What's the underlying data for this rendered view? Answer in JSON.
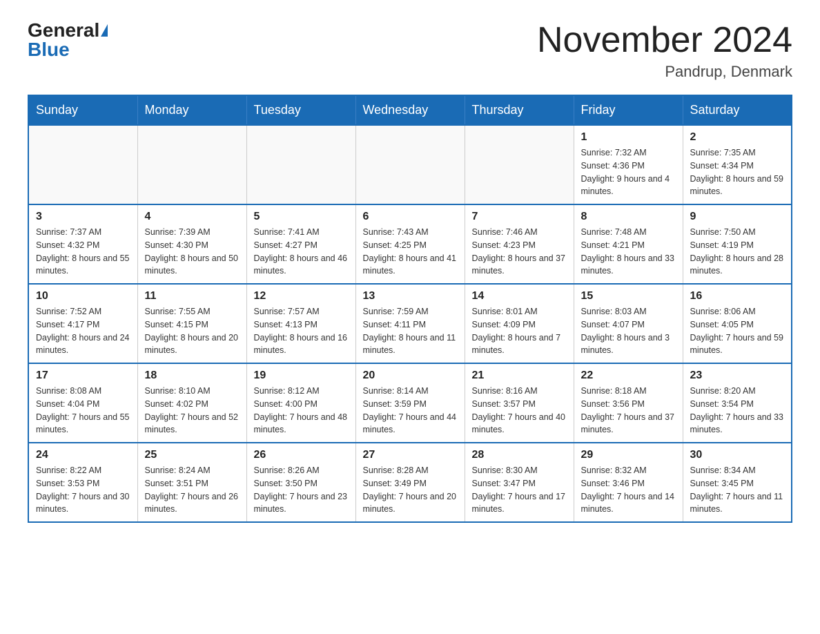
{
  "header": {
    "logo_general": "General",
    "logo_blue": "Blue",
    "month_title": "November 2024",
    "location": "Pandrup, Denmark"
  },
  "calendar": {
    "days_of_week": [
      "Sunday",
      "Monday",
      "Tuesday",
      "Wednesday",
      "Thursday",
      "Friday",
      "Saturday"
    ],
    "weeks": [
      {
        "days": [
          {
            "number": "",
            "info": ""
          },
          {
            "number": "",
            "info": ""
          },
          {
            "number": "",
            "info": ""
          },
          {
            "number": "",
            "info": ""
          },
          {
            "number": "",
            "info": ""
          },
          {
            "number": "1",
            "info": "Sunrise: 7:32 AM\nSunset: 4:36 PM\nDaylight: 9 hours\nand 4 minutes."
          },
          {
            "number": "2",
            "info": "Sunrise: 7:35 AM\nSunset: 4:34 PM\nDaylight: 8 hours\nand 59 minutes."
          }
        ]
      },
      {
        "days": [
          {
            "number": "3",
            "info": "Sunrise: 7:37 AM\nSunset: 4:32 PM\nDaylight: 8 hours\nand 55 minutes."
          },
          {
            "number": "4",
            "info": "Sunrise: 7:39 AM\nSunset: 4:30 PM\nDaylight: 8 hours\nand 50 minutes."
          },
          {
            "number": "5",
            "info": "Sunrise: 7:41 AM\nSunset: 4:27 PM\nDaylight: 8 hours\nand 46 minutes."
          },
          {
            "number": "6",
            "info": "Sunrise: 7:43 AM\nSunset: 4:25 PM\nDaylight: 8 hours\nand 41 minutes."
          },
          {
            "number": "7",
            "info": "Sunrise: 7:46 AM\nSunset: 4:23 PM\nDaylight: 8 hours\nand 37 minutes."
          },
          {
            "number": "8",
            "info": "Sunrise: 7:48 AM\nSunset: 4:21 PM\nDaylight: 8 hours\nand 33 minutes."
          },
          {
            "number": "9",
            "info": "Sunrise: 7:50 AM\nSunset: 4:19 PM\nDaylight: 8 hours\nand 28 minutes."
          }
        ]
      },
      {
        "days": [
          {
            "number": "10",
            "info": "Sunrise: 7:52 AM\nSunset: 4:17 PM\nDaylight: 8 hours\nand 24 minutes."
          },
          {
            "number": "11",
            "info": "Sunrise: 7:55 AM\nSunset: 4:15 PM\nDaylight: 8 hours\nand 20 minutes."
          },
          {
            "number": "12",
            "info": "Sunrise: 7:57 AM\nSunset: 4:13 PM\nDaylight: 8 hours\nand 16 minutes."
          },
          {
            "number": "13",
            "info": "Sunrise: 7:59 AM\nSunset: 4:11 PM\nDaylight: 8 hours\nand 11 minutes."
          },
          {
            "number": "14",
            "info": "Sunrise: 8:01 AM\nSunset: 4:09 PM\nDaylight: 8 hours\nand 7 minutes."
          },
          {
            "number": "15",
            "info": "Sunrise: 8:03 AM\nSunset: 4:07 PM\nDaylight: 8 hours\nand 3 minutes."
          },
          {
            "number": "16",
            "info": "Sunrise: 8:06 AM\nSunset: 4:05 PM\nDaylight: 7 hours\nand 59 minutes."
          }
        ]
      },
      {
        "days": [
          {
            "number": "17",
            "info": "Sunrise: 8:08 AM\nSunset: 4:04 PM\nDaylight: 7 hours\nand 55 minutes."
          },
          {
            "number": "18",
            "info": "Sunrise: 8:10 AM\nSunset: 4:02 PM\nDaylight: 7 hours\nand 52 minutes."
          },
          {
            "number": "19",
            "info": "Sunrise: 8:12 AM\nSunset: 4:00 PM\nDaylight: 7 hours\nand 48 minutes."
          },
          {
            "number": "20",
            "info": "Sunrise: 8:14 AM\nSunset: 3:59 PM\nDaylight: 7 hours\nand 44 minutes."
          },
          {
            "number": "21",
            "info": "Sunrise: 8:16 AM\nSunset: 3:57 PM\nDaylight: 7 hours\nand 40 minutes."
          },
          {
            "number": "22",
            "info": "Sunrise: 8:18 AM\nSunset: 3:56 PM\nDaylight: 7 hours\nand 37 minutes."
          },
          {
            "number": "23",
            "info": "Sunrise: 8:20 AM\nSunset: 3:54 PM\nDaylight: 7 hours\nand 33 minutes."
          }
        ]
      },
      {
        "days": [
          {
            "number": "24",
            "info": "Sunrise: 8:22 AM\nSunset: 3:53 PM\nDaylight: 7 hours\nand 30 minutes."
          },
          {
            "number": "25",
            "info": "Sunrise: 8:24 AM\nSunset: 3:51 PM\nDaylight: 7 hours\nand 26 minutes."
          },
          {
            "number": "26",
            "info": "Sunrise: 8:26 AM\nSunset: 3:50 PM\nDaylight: 7 hours\nand 23 minutes."
          },
          {
            "number": "27",
            "info": "Sunrise: 8:28 AM\nSunset: 3:49 PM\nDaylight: 7 hours\nand 20 minutes."
          },
          {
            "number": "28",
            "info": "Sunrise: 8:30 AM\nSunset: 3:47 PM\nDaylight: 7 hours\nand 17 minutes."
          },
          {
            "number": "29",
            "info": "Sunrise: 8:32 AM\nSunset: 3:46 PM\nDaylight: 7 hours\nand 14 minutes."
          },
          {
            "number": "30",
            "info": "Sunrise: 8:34 AM\nSunset: 3:45 PM\nDaylight: 7 hours\nand 11 minutes."
          }
        ]
      }
    ]
  }
}
